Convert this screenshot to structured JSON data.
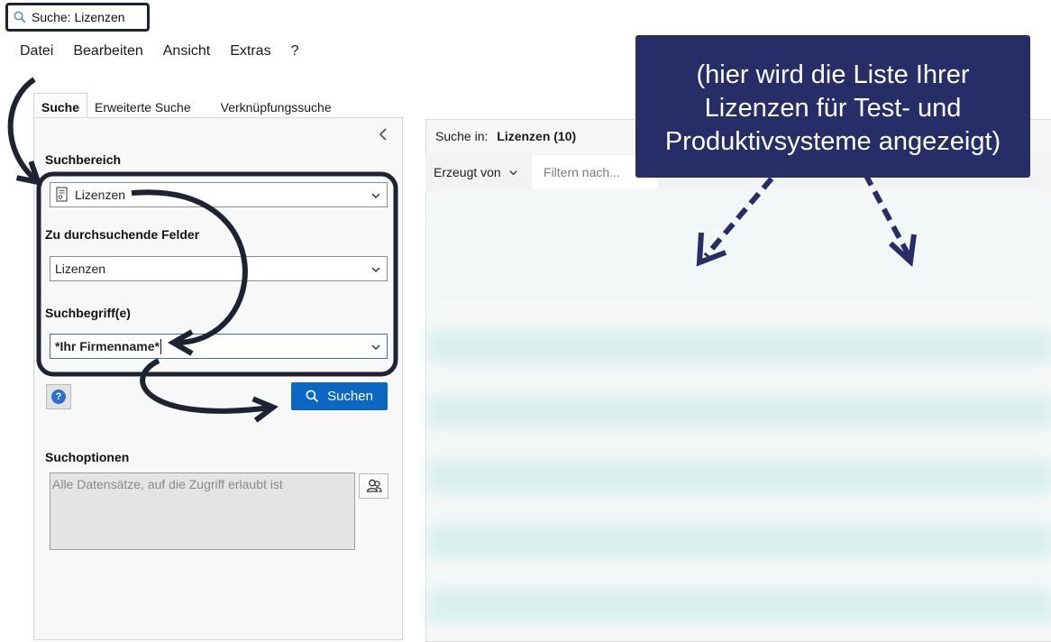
{
  "window": {
    "title": "Suche: Lizenzen"
  },
  "menu": [
    {
      "label": "Datei"
    },
    {
      "label": "Bearbeiten"
    },
    {
      "label": "Ansicht"
    },
    {
      "label": "Extras"
    },
    {
      "label": "?"
    }
  ],
  "tabs": [
    {
      "label": "Suche",
      "active": true
    },
    {
      "label": "Erweiterte Suche",
      "active": false
    },
    {
      "label": "Verknüpfungssuche",
      "active": false
    }
  ],
  "search_panel": {
    "area_label": "Suchbereich",
    "area_value": "Lizenzen",
    "fields_label": "Zu durchsuchende Felder",
    "fields_value": "Lizenzen",
    "term_label": "Suchbegriff(e)",
    "term_value": "*Ihr Firmenname*",
    "search_button": "Suchen",
    "options_label": "Suchoptionen",
    "options_value": "Alle Datensätze, auf die Zugriff erlaubt ist"
  },
  "results": {
    "search_in_label": "Suche in:",
    "search_in_value": "Lizenzen (10)",
    "created_by_label": "Erzeugt von",
    "filter_placeholder": "Filtern nach..."
  },
  "callout": {
    "line1": "(hier wird die Liste Ihrer",
    "line2": "Lizenzen für Test- und",
    "line3": "Produktivsysteme angezeigt)"
  },
  "colors": {
    "accent_button": "#0a67c2",
    "callout_bg": "#272d66",
    "annotation_stroke": "#1e2233",
    "blurred_row_teal": "#d9efee"
  }
}
